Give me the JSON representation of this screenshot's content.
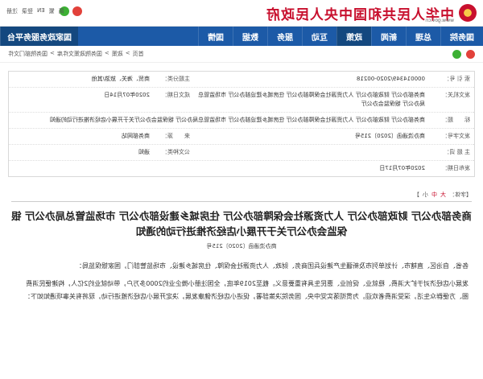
{
  "header": {
    "site_title": "中华人民共和国中央人民政府",
    "site_url": "www.gov.cn",
    "top_links": [
      "简",
      "繁",
      "EN",
      "登录",
      "注册"
    ]
  },
  "nav": {
    "items": [
      "国务院",
      "总理",
      "新闻",
      "政策",
      "互动",
      "服务",
      "数据",
      "国情"
    ],
    "platform": "国家政务服务平台"
  },
  "subbar": {
    "breadcrumb": [
      "首页",
      ">",
      "政策",
      ">",
      "国务院政策文件库",
      ">",
      "国务院部门文件"
    ]
  },
  "meta": {
    "index_label": "索 引 号：",
    "index_value": "000014349/2020-00218",
    "topic_label": "主题分类：",
    "topic_value": "商贸、海关、旅游/其他",
    "issuer_label": "发文机关：",
    "issuer_value": "商务部办公厅 财政部办公厅 人力资源社会保障部办公厅 住房城乡建设部办公厅 市场监管总局办公厅 银保监会办公厅",
    "date_label": "成文日期：",
    "date_value": "2020年07月14日",
    "title_label": "标　　题：",
    "title_value": "商务部办公厅 财政部办公厅 人力资源社会保障部办公厅 住房城乡建设部办公厅 市场监管总局办公厅 银保监会办公厅关于开展小店经济推进行动的通知",
    "docno_label": "发文字号：",
    "docno_value": "商办流通函〔2020〕215号",
    "source_label": "来　　源：",
    "source_value": "商务部网站",
    "pubdate_label": "发布日期：",
    "pubdate_value": "2020年07月17日",
    "keywords_label": "主 题 词：",
    "keywords_value": "",
    "type_label": "公文种类：",
    "type_value": "通知"
  },
  "fontsize": {
    "label": "【字体：",
    "big": "大",
    "mid": "中",
    "small": "小",
    "close": "】"
  },
  "article": {
    "title": "商务部办公厅 财政部办公厅 人力资源社会保障部办公厅 住房城乡建设部办公厅 市场监管总局办公厅 银保监会办公厅关于开展小店经济推进行动的通知",
    "docno": "商办流通函〔2020〕215号",
    "paragraphs": [
      "各省、自治区、直辖市、计划单列市及新疆生产建设兵团商务、财政、人力资源社会保障、住房城乡建设、市场监管部门，国家银保监局：",
      "发展小店经济对于扩大消费、稳就业、促创业、惠民生具有重要意义。截至2019年底，全国注册小微企业约2000多万户，带动就业约2亿人，构建便民消费圈、方便群众生活，深受消费者欢迎。为贯彻落实党中央、国务院决策部署，促进小店经济健康发展，决定开展小店经济推进行动，现将有关事项通知如下："
    ]
  }
}
